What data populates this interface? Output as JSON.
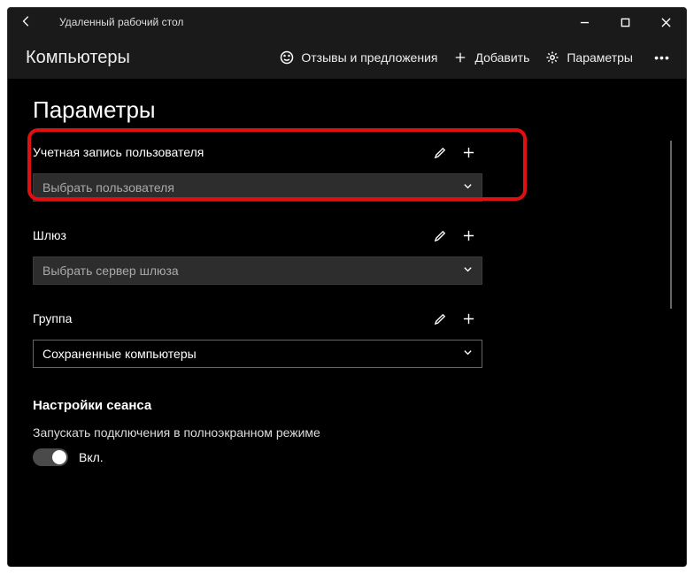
{
  "titlebar": {
    "app_name": "Удаленный рабочий стол"
  },
  "commandbar": {
    "heading": "Компьютеры",
    "feedback": "Отзывы и предложения",
    "add": "Добавить",
    "settings": "Параметры"
  },
  "page": {
    "title": "Параметры"
  },
  "sections": {
    "user_account": {
      "label": "Учетная запись пользователя",
      "placeholder": "Выбрать пользователя"
    },
    "gateway": {
      "label": "Шлюз",
      "placeholder": "Выбрать сервер шлюза"
    },
    "group": {
      "label": "Группа",
      "value": "Сохраненные компьютеры"
    }
  },
  "session": {
    "heading": "Настройки сеанса",
    "fullscreen_label": "Запускать подключения в полноэкранном режиме",
    "toggle_state": "Вкл."
  }
}
